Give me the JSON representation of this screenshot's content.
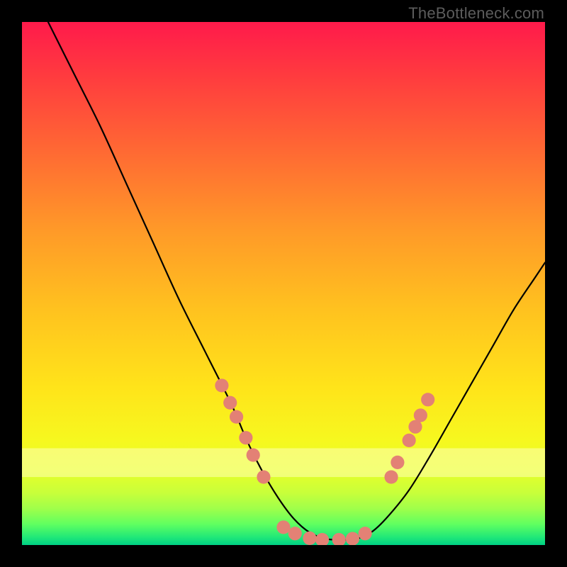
{
  "watermark": "TheBottleneck.com",
  "gradient": {
    "stops": [
      {
        "offset": 0.0,
        "color": "#ff1a4b"
      },
      {
        "offset": 0.1,
        "color": "#ff3a3f"
      },
      {
        "offset": 0.25,
        "color": "#ff6a33"
      },
      {
        "offset": 0.4,
        "color": "#ff9a28"
      },
      {
        "offset": 0.55,
        "color": "#ffc21f"
      },
      {
        "offset": 0.7,
        "color": "#ffe41a"
      },
      {
        "offset": 0.8,
        "color": "#f6f81f"
      },
      {
        "offset": 0.86,
        "color": "#e6ff2a"
      },
      {
        "offset": 0.9,
        "color": "#c8ff3a"
      },
      {
        "offset": 0.93,
        "color": "#a0ff4a"
      },
      {
        "offset": 0.96,
        "color": "#60ff60"
      },
      {
        "offset": 0.985,
        "color": "#20e878"
      },
      {
        "offset": 1.0,
        "color": "#00d084"
      }
    ]
  },
  "highlight_band": {
    "top": 0.815,
    "bottom": 0.87,
    "color": "#feffb0",
    "opacity": 0.58
  },
  "chart_data": {
    "type": "line",
    "title": "",
    "xlabel": "",
    "ylabel": "",
    "xlim": [
      0,
      100
    ],
    "ylim": [
      0,
      100
    ],
    "grid": false,
    "series": [
      {
        "name": "bottleneck-curve",
        "x": [
          5,
          10,
          15,
          20,
          25,
          30,
          35,
          40,
          43,
          46,
          49,
          52,
          55,
          58,
          61,
          64,
          67,
          70,
          74,
          78,
          82,
          86,
          90,
          94,
          98,
          100
        ],
        "y": [
          100,
          90,
          80,
          69,
          58,
          47,
          37,
          27,
          20,
          14,
          9,
          5,
          2.4,
          1.2,
          1.0,
          1.2,
          2.6,
          5.5,
          10.5,
          17,
          24,
          31,
          38,
          45,
          51,
          54
        ]
      }
    ],
    "markers": {
      "name": "intersection-markers",
      "color": "#e38175",
      "radius_frac": 0.013,
      "points": [
        {
          "x": 38.2,
          "y": 30.5
        },
        {
          "x": 39.8,
          "y": 27.2
        },
        {
          "x": 41.0,
          "y": 24.5
        },
        {
          "x": 42.8,
          "y": 20.5
        },
        {
          "x": 44.2,
          "y": 17.2
        },
        {
          "x": 46.2,
          "y": 13.0
        },
        {
          "x": 50.0,
          "y": 3.4
        },
        {
          "x": 52.2,
          "y": 2.2
        },
        {
          "x": 55.0,
          "y": 1.3
        },
        {
          "x": 57.4,
          "y": 1.0
        },
        {
          "x": 60.6,
          "y": 1.0
        },
        {
          "x": 63.2,
          "y": 1.2
        },
        {
          "x": 65.6,
          "y": 2.2
        },
        {
          "x": 70.6,
          "y": 13.0
        },
        {
          "x": 71.8,
          "y": 15.8
        },
        {
          "x": 74.0,
          "y": 20.0
        },
        {
          "x": 75.2,
          "y": 22.6
        },
        {
          "x": 76.2,
          "y": 24.8
        },
        {
          "x": 77.6,
          "y": 27.8
        }
      ]
    }
  }
}
